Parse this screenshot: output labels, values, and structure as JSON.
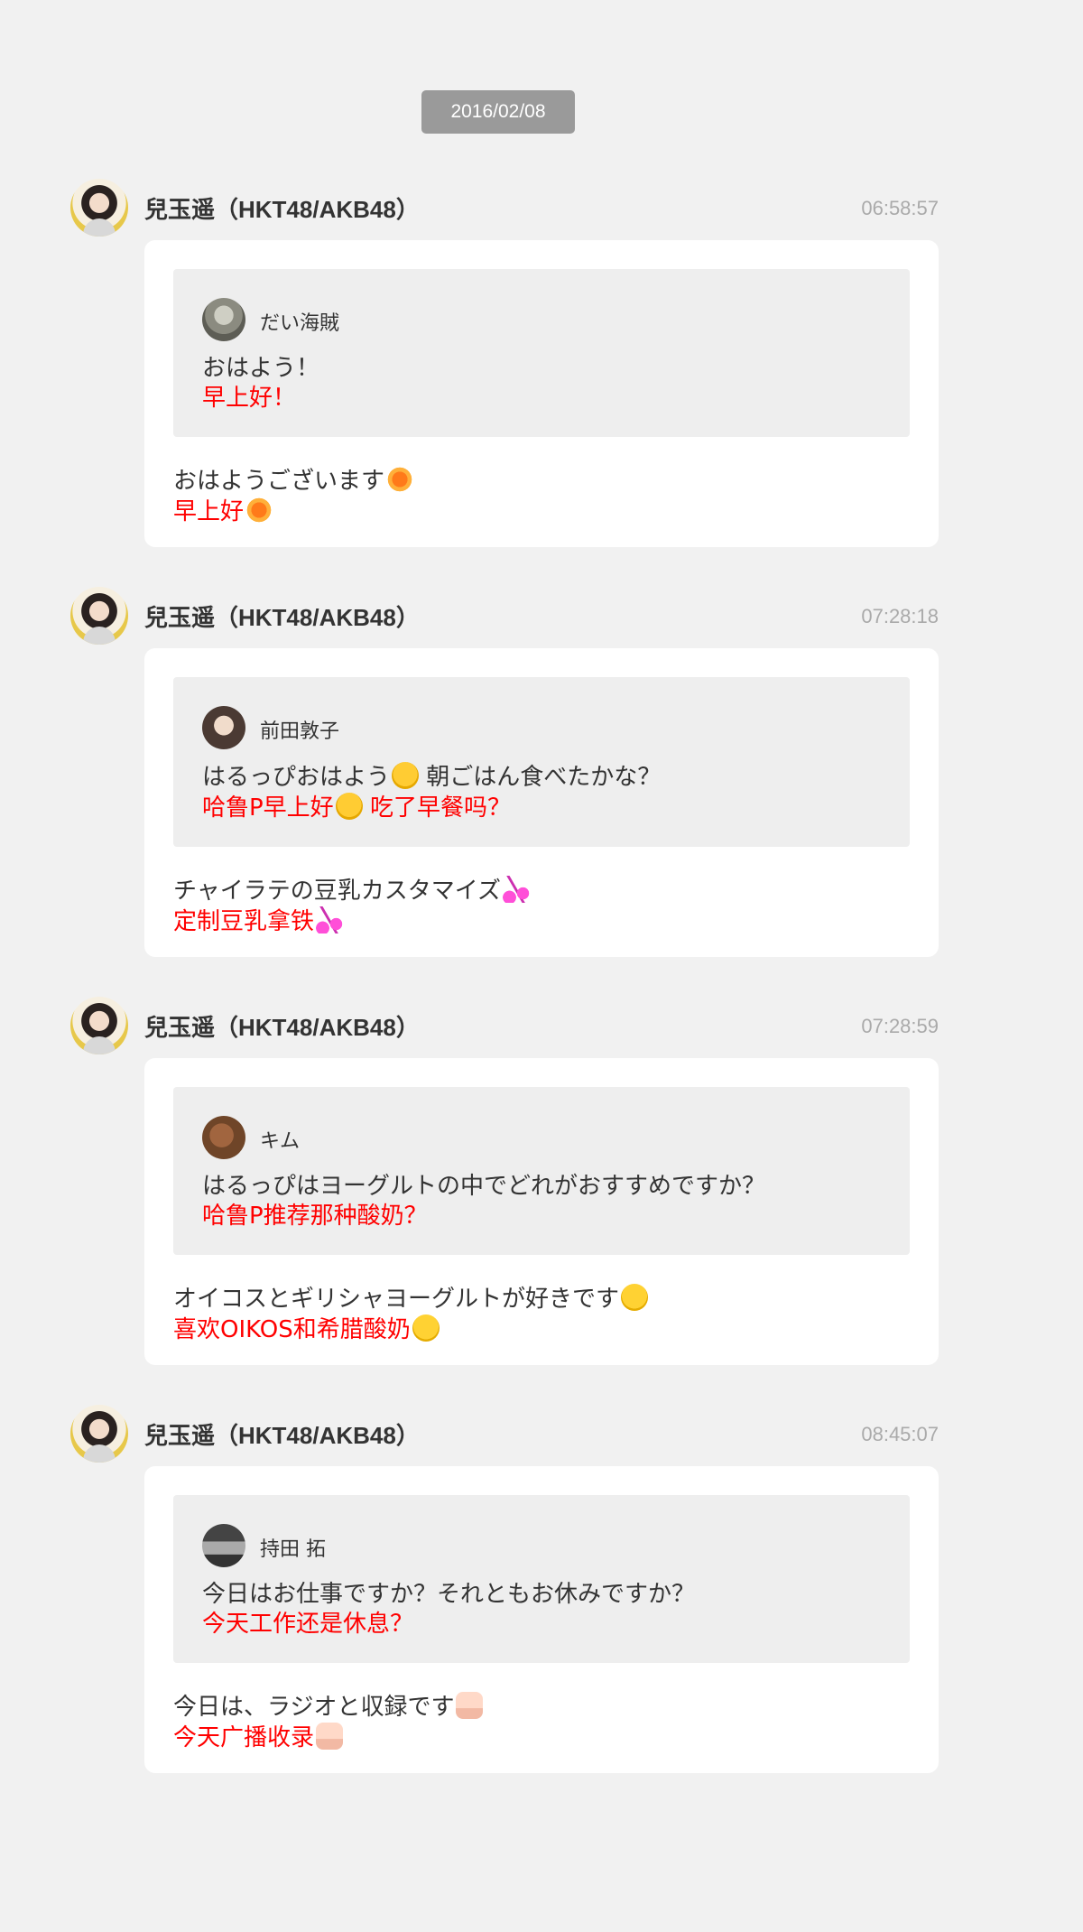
{
  "date": "2016/02/08",
  "posts": [
    {
      "author": "兒玉遥（HKT48/AKB48）",
      "time": "06:58:57",
      "quote": {
        "user": "だい海賊",
        "text": "おはよう！",
        "translation": "早上好！"
      },
      "reply": {
        "text": "おはようございます",
        "translation": "早上好"
      },
      "emoji": "sun-emoji"
    },
    {
      "author": "兒玉遥（HKT48/AKB48）",
      "time": "07:28:18",
      "quote": {
        "user": "前田敦子",
        "text_a": "はるっぴおはよう",
        "text_b": " 朝ごはん食べたかな？",
        "translation_a": "哈鲁P早上好",
        "translation_b": " 吃了早餐吗？"
      },
      "reply": {
        "text": "チャイラテの豆乳カスタマイズ",
        "translation": "定制豆乳拿铁"
      },
      "emoji": "music-note-emoji"
    },
    {
      "author": "兒玉遥（HKT48/AKB48）",
      "time": "07:28:59",
      "quote": {
        "user": "キム",
        "text": "はるっぴはヨーグルトの中でどれがおすすめですか？",
        "translation": "哈鲁P推荐那种酸奶？"
      },
      "reply": {
        "text": "オイコスとギリシャヨーグルトが好きです",
        "translation": "喜欢OIKOS和希腊酸奶"
      },
      "emoji": "smile-emoji"
    },
    {
      "author": "兒玉遥（HKT48/AKB48）",
      "time": "08:45:07",
      "quote": {
        "user": "持田 拓",
        "text": "今日はお仕事ですか？それともお休みですか？",
        "translation": "今天工作还是休息？"
      },
      "reply": {
        "text": "今日は、ラジオと収録です",
        "translation": "今天广播收录"
      },
      "emoji": "fist-emoji"
    }
  ]
}
